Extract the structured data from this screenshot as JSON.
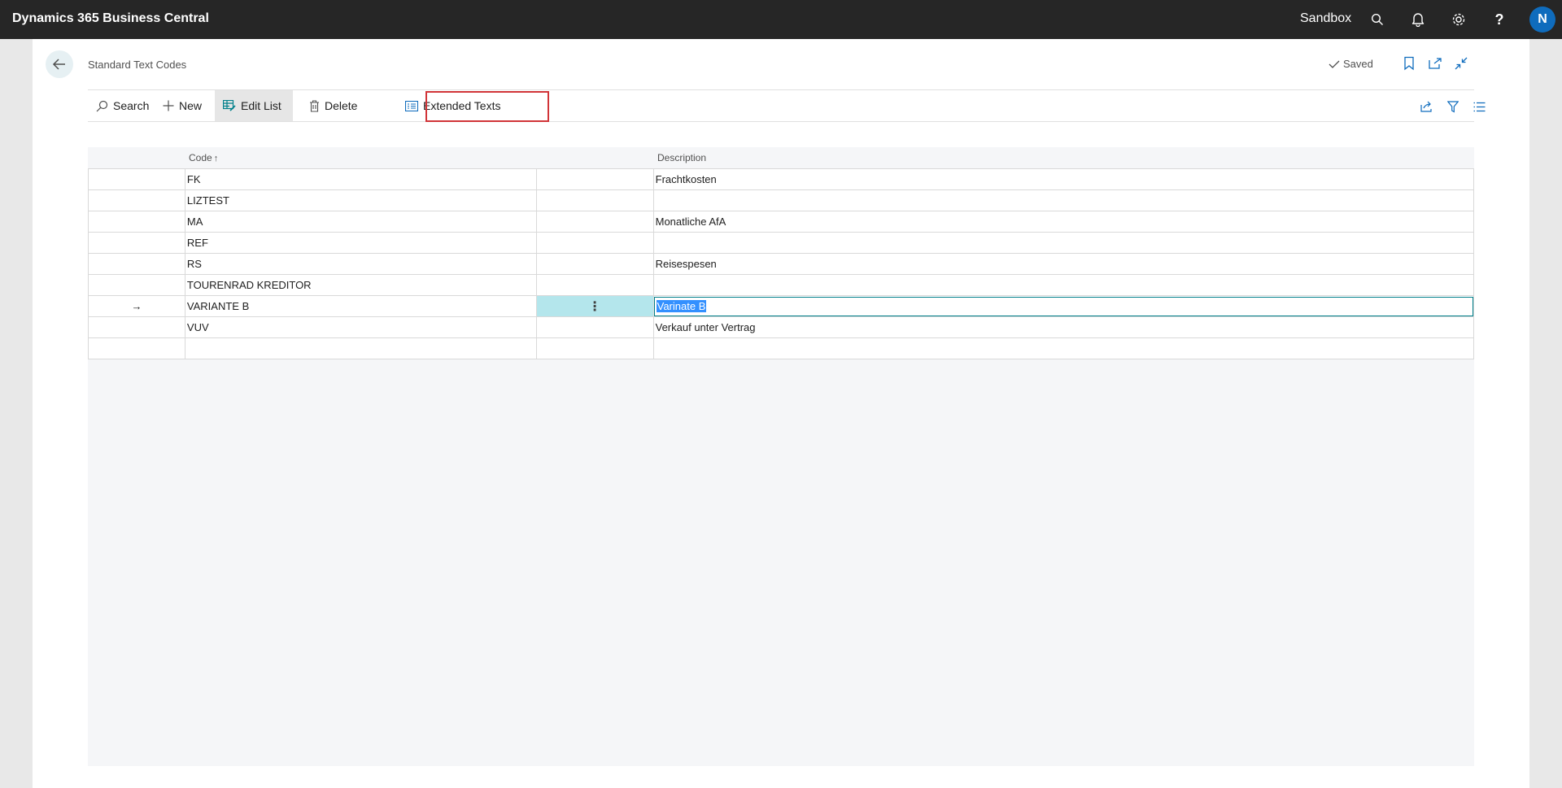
{
  "topbar": {
    "app_title": "Dynamics 365 Business Central",
    "environment": "Sandbox",
    "icons": [
      "search-icon",
      "bell-icon",
      "gear-icon",
      "help-icon"
    ],
    "avatar_initial": "N",
    "avatar_color": "#0f6cbd"
  },
  "page": {
    "title": "Standard Text Codes",
    "status": "Saved"
  },
  "actions": {
    "search": "Search",
    "new": "New",
    "edit_list": "Edit List",
    "delete": "Delete",
    "extended_texts": "Extended Texts"
  },
  "columns": {
    "code": "Code",
    "description": "Description"
  },
  "rows": [
    {
      "code": "FK",
      "description": "Frachtkosten"
    },
    {
      "code": "LIZTEST",
      "description": ""
    },
    {
      "code": "MA",
      "description": "Monatliche AfA"
    },
    {
      "code": "REF",
      "description": ""
    },
    {
      "code": "RS",
      "description": "Reisespesen"
    },
    {
      "code": "TOURENRAD KREDITOR",
      "description": ""
    },
    {
      "code": "VARIANTE B",
      "description": "Varinate B",
      "current": true
    },
    {
      "code": "VUV",
      "description": "Verkauf unter Vertrag"
    },
    {
      "code": "",
      "description": ""
    }
  ],
  "current_row_marker": "→",
  "row_menu_glyph": "⋮",
  "colors": {
    "topbar": "#262626",
    "highlight": "#d13438",
    "current_cell": "#b4e6ec",
    "edit_border": "#00808b",
    "text_selection": "#3390ff"
  }
}
